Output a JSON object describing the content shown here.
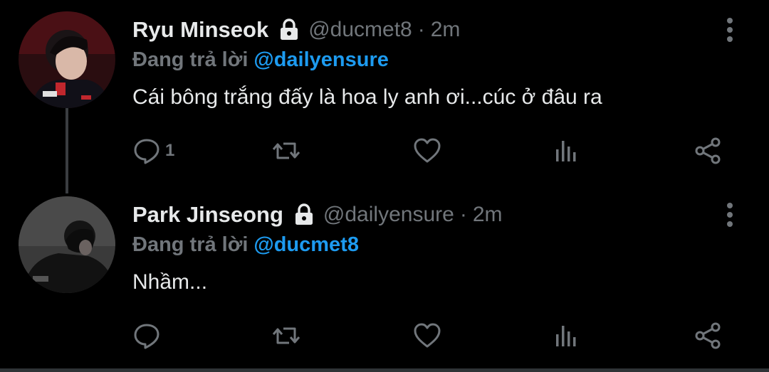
{
  "colors": {
    "background": "#000000",
    "text": "#e7e9ea",
    "muted": "#71767b",
    "accent": "#1d9bf0"
  },
  "tweets": [
    {
      "name": "Ryu Minseok",
      "protected_icon": "lock-icon",
      "handle": "@ducmet8",
      "separator": "·",
      "time": "2m",
      "reply_prefix": "Đang trả lời",
      "reply_to": "@dailyensure",
      "text": "Cái bông trắng đấy là hoa ly anh ơi...cúc ở đâu ra",
      "reply_count": "1",
      "icons": [
        "reply-icon",
        "retweet-icon",
        "like-icon",
        "stats-icon",
        "share-icon",
        "more-icon"
      ]
    },
    {
      "name": "Park Jinseong",
      "protected_icon": "lock-icon",
      "handle": "@dailyensure",
      "separator": "·",
      "time": "2m",
      "reply_prefix": "Đang trả lời",
      "reply_to": "@ducmet8",
      "text": "Nhầm...",
      "reply_count": "",
      "icons": [
        "reply-icon",
        "retweet-icon",
        "like-icon",
        "stats-icon",
        "share-icon",
        "more-icon"
      ]
    }
  ]
}
